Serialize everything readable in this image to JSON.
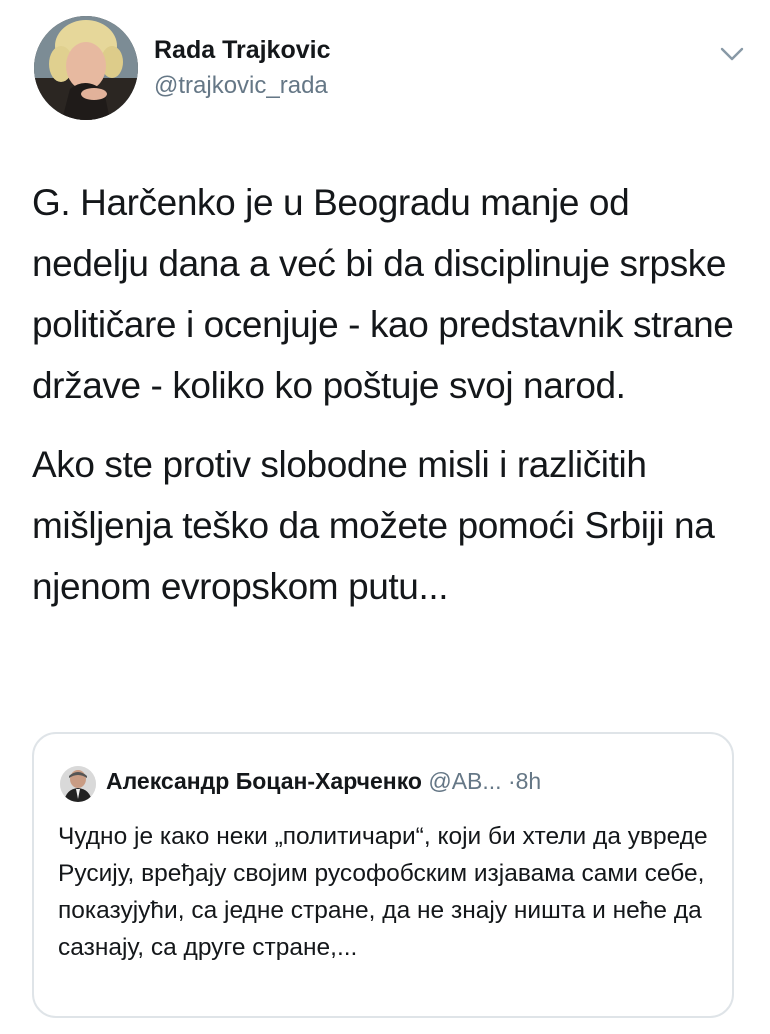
{
  "author": {
    "name": "Rada Trajkovic",
    "handle": "@trajkovic_rada",
    "avatar_icon": "profile-photo"
  },
  "more_icon": "chevron-down-icon",
  "tweet": {
    "paragraphs": [
      "G. Harčenko je u Beogradu manje od nedelju dana a već bi da disciplinuje srpske političare i ocenjuje - kao predstavnik strane države - koliko ko poštuje svoj narod.",
      "Ako ste protiv slobodne misli i različitih mišljenja teško da možete pomoći Srbiji na njenom evropskom putu..."
    ]
  },
  "quoted_tweet": {
    "name": "Александр Боцан-Харченко",
    "handle": "@AB...",
    "separator": "·",
    "time": "8h",
    "text": "Чудно је како неки „политичари“, који би хтели да увреде Русију, вређају својим русофобским изјавама сами себе, показујући, са једне стране, да не знају ништа и неће да сазнају, са друге стране,..."
  },
  "colors": {
    "text_primary": "#14171a",
    "text_secondary": "#657786",
    "border": "#dfe4e8"
  }
}
